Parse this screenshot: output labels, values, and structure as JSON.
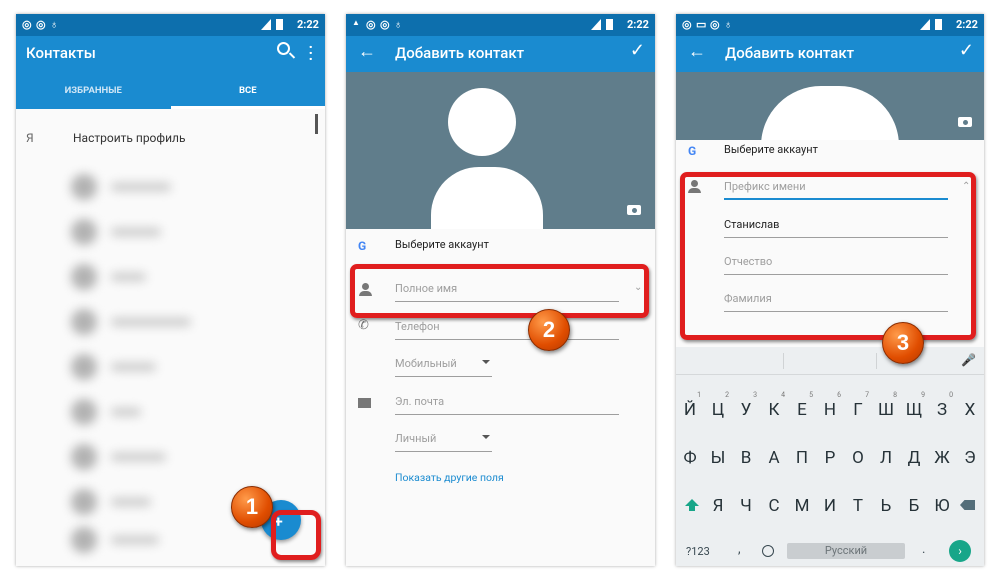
{
  "screen1": {
    "status_time": "2:22",
    "title": "Контакты",
    "tabs": [
      "ИЗБРАННЫЕ",
      "ВСЕ"
    ],
    "self_letter": "Я",
    "self_label": "Настроить профиль",
    "badge": "1"
  },
  "screen2": {
    "status_time": "2:22",
    "title": "Добавить контакт",
    "account": "Выберите аккаунт",
    "google_glyph": "G",
    "fullname_placeholder": "Полное имя",
    "phone_placeholder": "Телефон",
    "phone_type": "Мобильный",
    "email_placeholder": "Эл. почта",
    "email_type": "Личный",
    "more_fields": "Показать другие поля",
    "badge": "2"
  },
  "screen3": {
    "status_time": "2:22",
    "title": "Добавить контакт",
    "account": "Выберите аккаунт",
    "google_glyph": "G",
    "prefix_placeholder": "Префикс имени",
    "first_name_value": "Станислав",
    "middle_placeholder": "Отчество",
    "last_placeholder": "Фамилия",
    "badge": "3",
    "keyboard": {
      "row1": [
        "Й",
        "Ц",
        "У",
        "К",
        "Е",
        "Н",
        "Г",
        "Ш",
        "Щ",
        "З",
        "Х"
      ],
      "row1_hints": [
        "1",
        "2",
        "3",
        "4",
        "5",
        "6",
        "7",
        "8",
        "9",
        "0",
        ""
      ],
      "row2": [
        "Ф",
        "Ы",
        "В",
        "А",
        "П",
        "Р",
        "О",
        "Л",
        "Д",
        "Ж",
        "Э"
      ],
      "row3": [
        "Я",
        "Ч",
        "С",
        "М",
        "И",
        "Т",
        "Ь",
        "Б",
        "Ю"
      ],
      "symbols_key": "?123",
      "comma_key": ",",
      "space_label": "Русский",
      "period_key": "."
    }
  },
  "colors": {
    "statusbar": "#0d6fad",
    "appbar": "#1a8bd0",
    "photo_bg": "#607d8b",
    "highlight": "#e01e1e",
    "badge": "#f06a1a",
    "keyboard_accent": "#18a689"
  }
}
